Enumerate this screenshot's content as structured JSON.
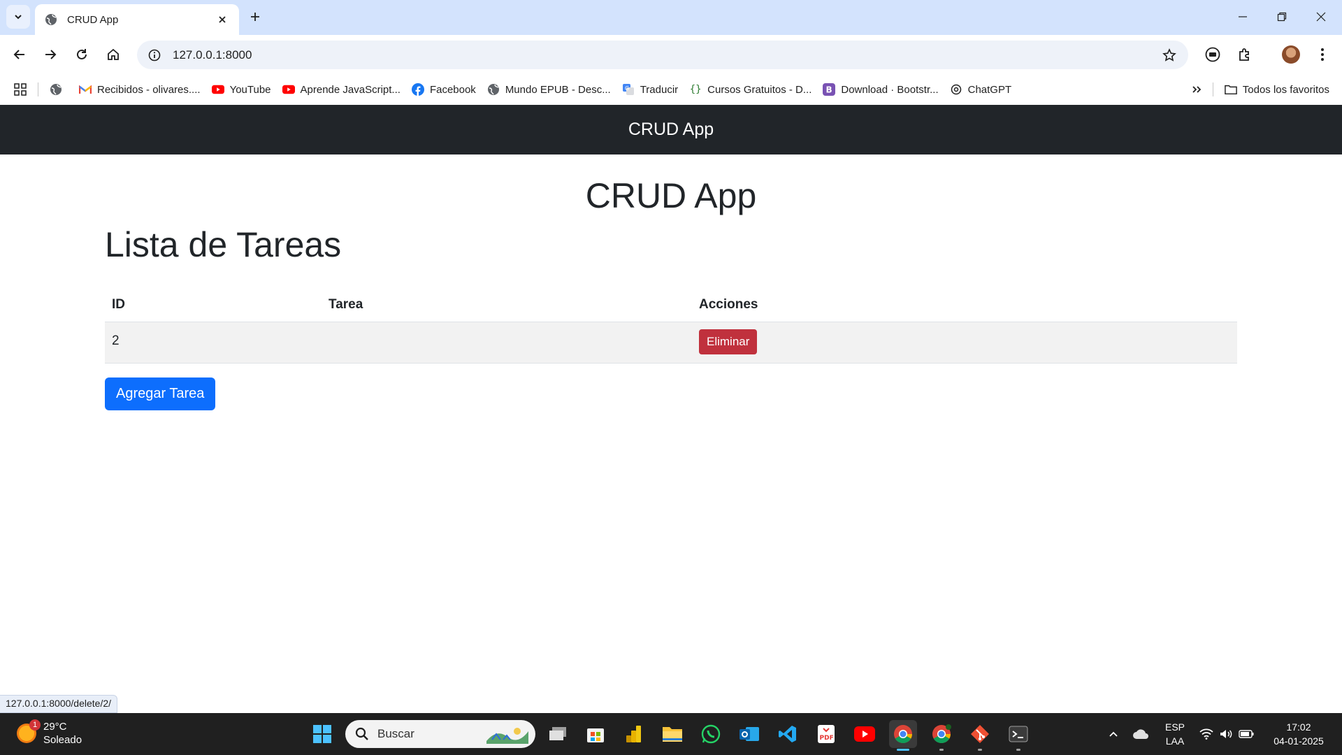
{
  "browser": {
    "tab_title": "CRUD App",
    "url": "127.0.0.1:8000",
    "bookmarks": [
      {
        "label": "Recibidos - olivares....",
        "icon": "gmail-icon"
      },
      {
        "label": "YouTube",
        "icon": "youtube-icon"
      },
      {
        "label": "Aprende JavaScript...",
        "icon": "youtube-icon"
      },
      {
        "label": "Facebook",
        "icon": "facebook-icon"
      },
      {
        "label": "Mundo EPUB - Desc...",
        "icon": "globe-icon"
      },
      {
        "label": "Traducir",
        "icon": "translate-icon"
      },
      {
        "label": "Cursos Gratuitos - D...",
        "icon": "code-braces-icon"
      },
      {
        "label": "Download · Bootstr...",
        "icon": "bootstrap-icon"
      },
      {
        "label": "ChatGPT",
        "icon": "chatgpt-icon"
      }
    ],
    "all_bookmarks": "Todos los favoritos",
    "status_url": "127.0.0.1:8000/delete/2/"
  },
  "page": {
    "navbar_brand": "CRUD App",
    "title": "CRUD App",
    "section_title": "Lista de Tareas",
    "table": {
      "headers": [
        "ID",
        "Tarea",
        "Acciones"
      ],
      "rows": [
        {
          "id": "2",
          "tarea": "",
          "action_label": "Eliminar"
        }
      ]
    },
    "add_button": "Agregar Tarea"
  },
  "taskbar": {
    "weather_temp": "29°C",
    "weather_desc": "Soleado",
    "weather_badge": "1",
    "search_placeholder": "Buscar",
    "lang_1": "ESP",
    "lang_2": "LAA",
    "time": "17:02",
    "date": "04-01-2025"
  },
  "colors": {
    "navbar_bg": "#212529",
    "danger": "#c0313d",
    "primary": "#0d6efd",
    "tabbar_bg": "#d3e3fd"
  }
}
